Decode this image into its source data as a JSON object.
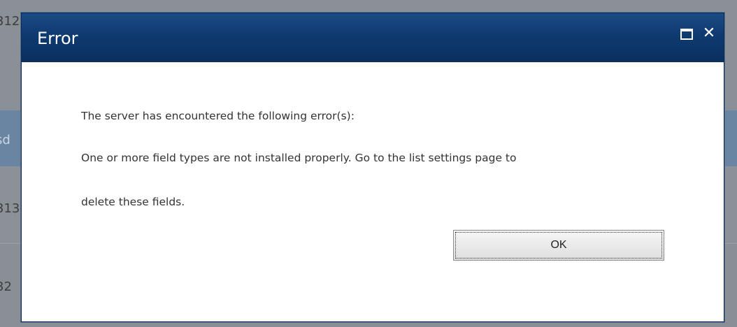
{
  "background": {
    "fragments": [
      "312",
      "sd",
      "313",
      "32"
    ]
  },
  "dialog": {
    "title": "Error",
    "maximize_icon": "maximize-icon",
    "close_label": "✕",
    "messages": [
      "The server has encountered the following error(s):",
      "One or more field types are not installed properly. Go to the list settings page to",
      "delete these fields."
    ],
    "ok_label": "OK"
  },
  "colors": {
    "titlebar": "#0f3a70",
    "overlay": "#8a8f96",
    "text": "#333333"
  }
}
